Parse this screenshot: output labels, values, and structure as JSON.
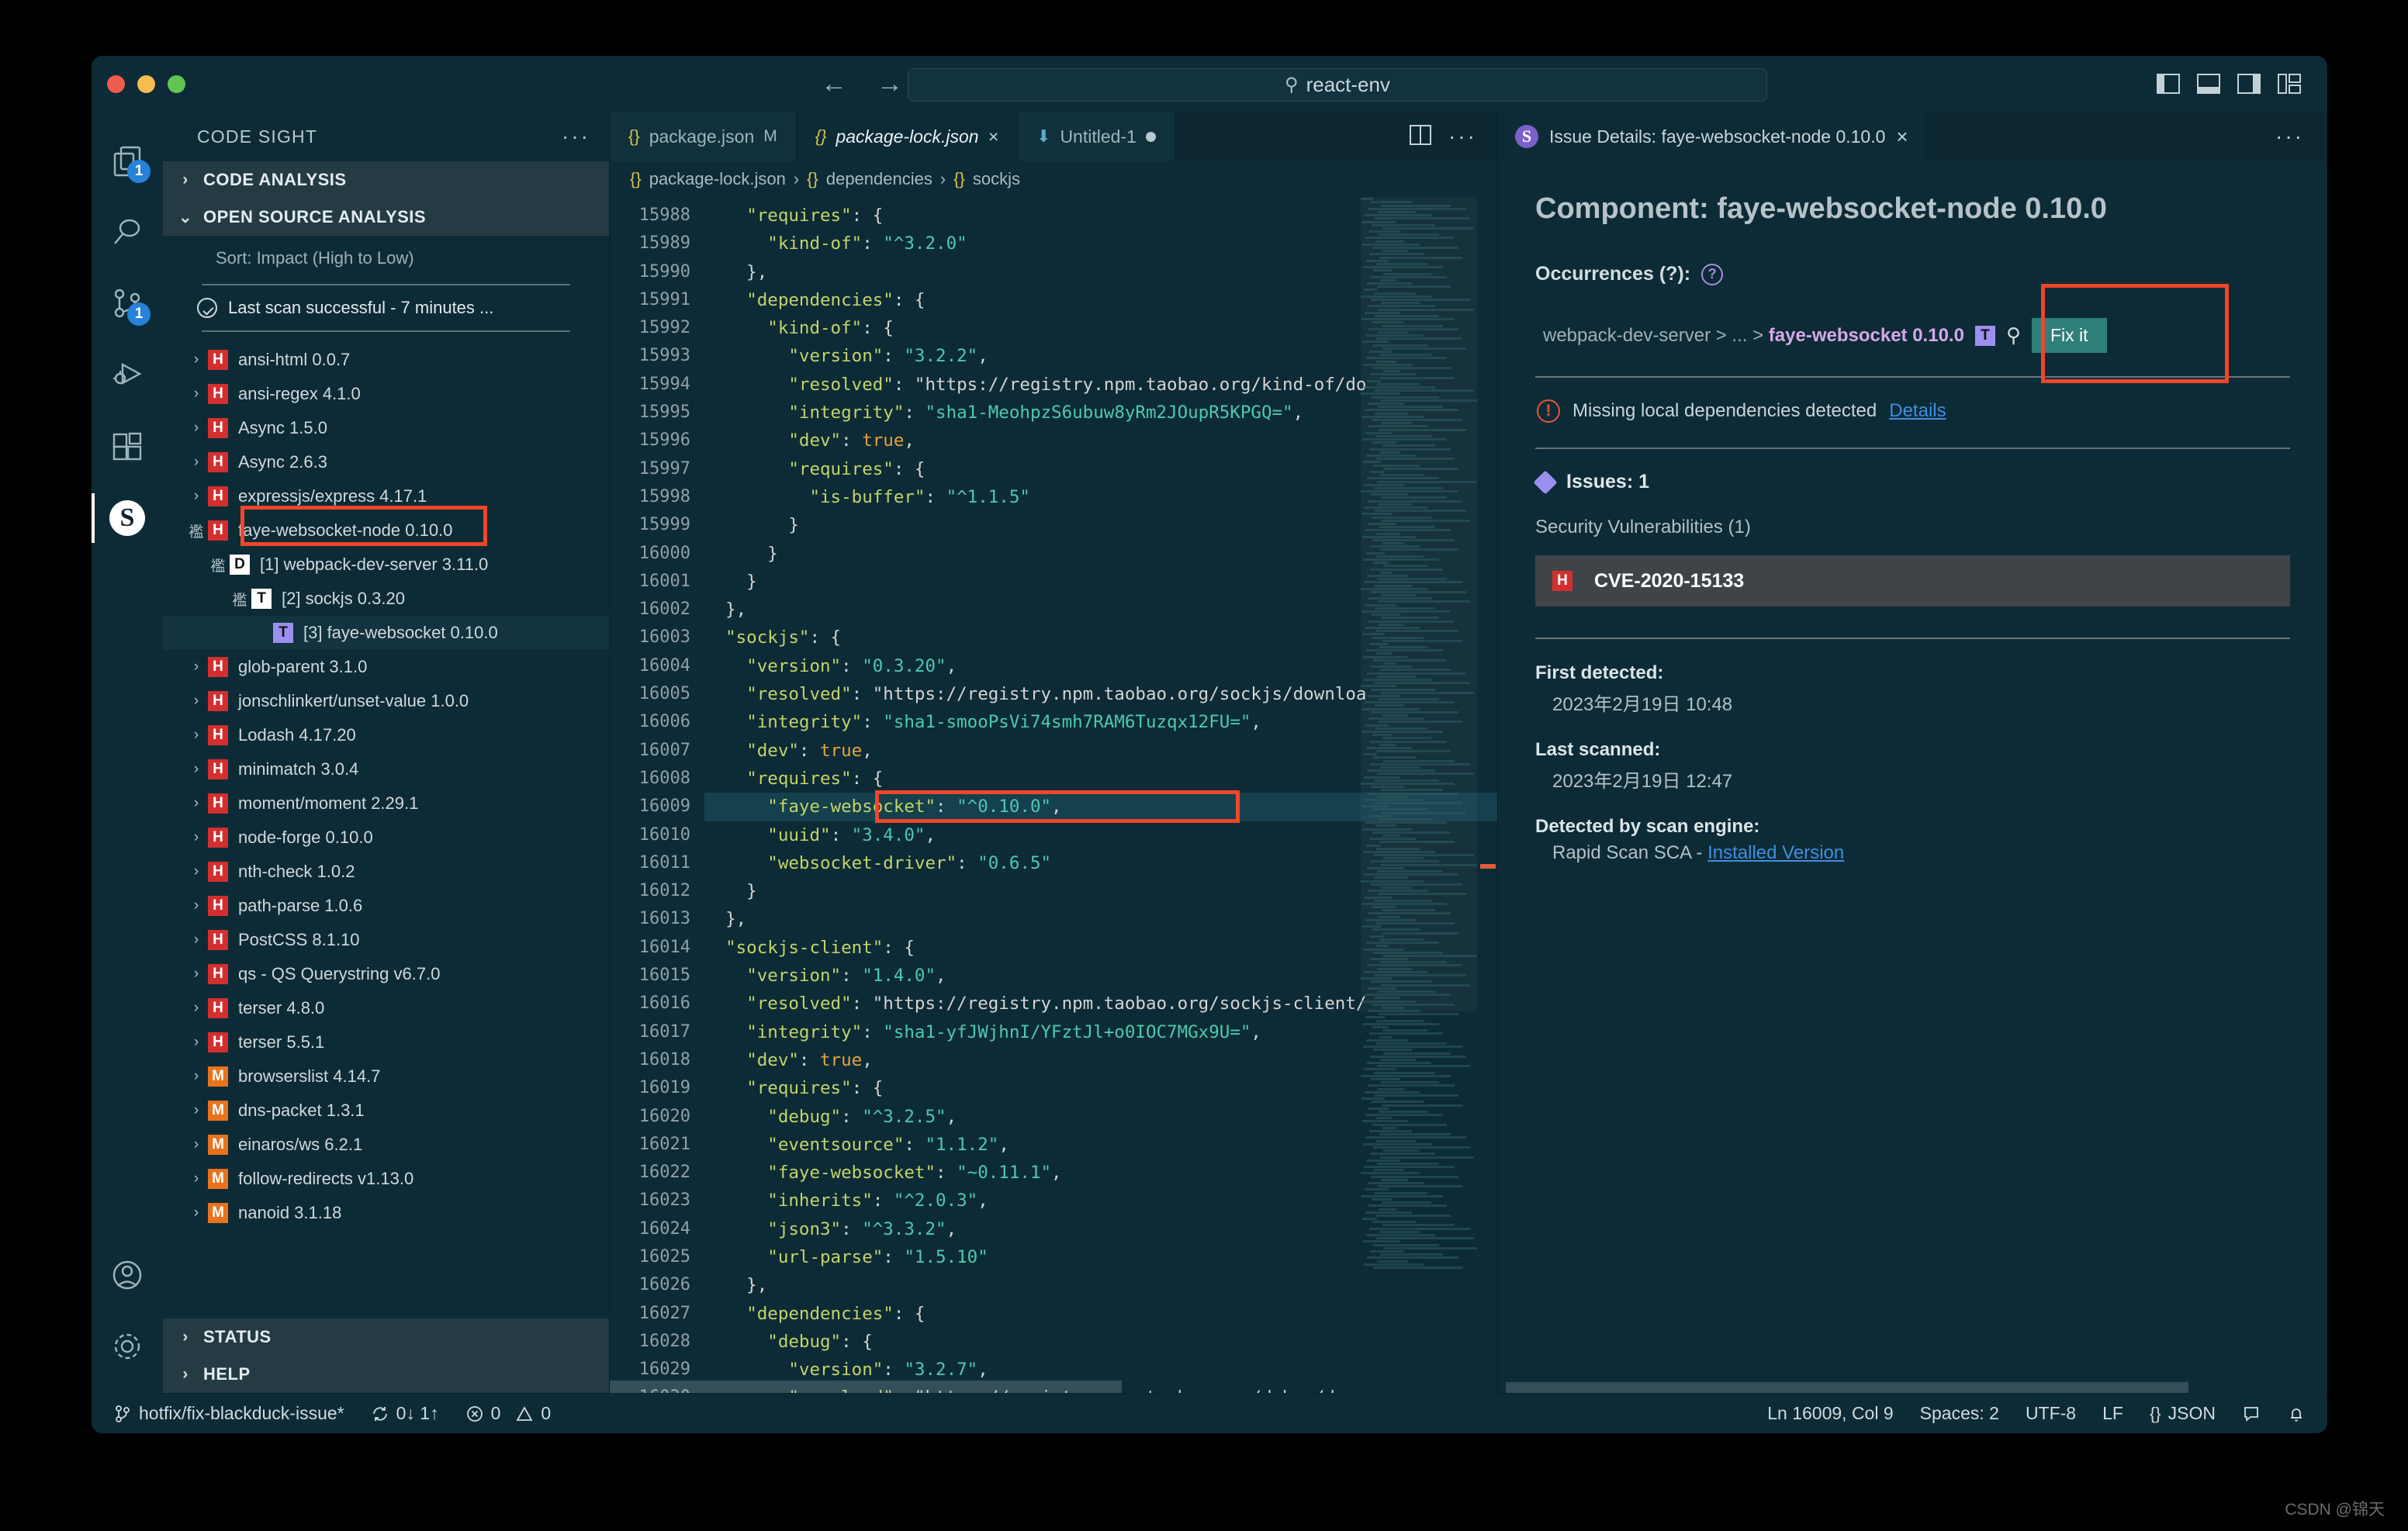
{
  "titlebar": {
    "omnibox_value": "react-env",
    "search_icon": "search-icon",
    "back_icon": "arrow-left-icon",
    "forward_icon": "arrow-right-icon"
  },
  "activity_bar": {
    "items": [
      {
        "name": "explorer",
        "icon": "files-icon",
        "badge": "1"
      },
      {
        "name": "search",
        "icon": "search-icon",
        "badge": ""
      },
      {
        "name": "source-control",
        "icon": "source-control-icon",
        "badge": "1"
      },
      {
        "name": "run-and-debug",
        "icon": "run-debug-icon",
        "badge": ""
      },
      {
        "name": "extensions",
        "icon": "extensions-icon",
        "badge": ""
      },
      {
        "name": "code-sight",
        "icon": "synopsys-s-icon",
        "badge": "",
        "letter": "S"
      }
    ],
    "bottom": [
      {
        "name": "accounts",
        "icon": "account-icon"
      },
      {
        "name": "settings",
        "icon": "gear-icon"
      }
    ]
  },
  "sidebar": {
    "title": "CODE SIGHT",
    "more_label": "···",
    "sections": [
      {
        "label": "CODE ANALYSIS",
        "expanded": false,
        "chevron": "chevron-right-icon"
      },
      {
        "label": "OPEN SOURCE ANALYSIS",
        "expanded": true,
        "chevron": "chevron-down-icon"
      }
    ],
    "sort_label": "Sort: Impact (High to Low)",
    "scan_status": "Last scan successful - 7 minutes ...",
    "tree": [
      {
        "label": "ansi-html 0.0.7",
        "sev": "H",
        "indent": 0,
        "arrow": "›"
      },
      {
        "label": "ansi-regex 4.1.0",
        "sev": "H",
        "indent": 0,
        "arrow": "›"
      },
      {
        "label": "Async 1.5.0",
        "sev": "H",
        "indent": 0,
        "arrow": "›"
      },
      {
        "label": "Async 2.6.3",
        "sev": "H",
        "indent": 0,
        "arrow": "›"
      },
      {
        "label": "expressjs/express 4.17.1",
        "sev": "H",
        "indent": 0,
        "arrow": "›"
      },
      {
        "label": "faye-websocket-node 0.10.0",
        "sev": "H",
        "indent": 0,
        "arrow": "∨"
      },
      {
        "label": "[1] webpack-dev-server 3.11.0",
        "sev": "D",
        "indent": 1,
        "arrow": "∨"
      },
      {
        "label": "[2] sockjs 0.3.20",
        "sev": "T",
        "indent": 2,
        "arrow": "∨"
      },
      {
        "label": "[3] faye-websocket 0.10.0",
        "sev": "Tsel",
        "indent": 3,
        "arrow": "",
        "selected": true
      },
      {
        "label": "glob-parent 3.1.0",
        "sev": "H",
        "indent": 0,
        "arrow": "›"
      },
      {
        "label": "jonschlinkert/unset-value 1.0.0",
        "sev": "H",
        "indent": 0,
        "arrow": "›"
      },
      {
        "label": "Lodash 4.17.20",
        "sev": "H",
        "indent": 0,
        "arrow": "›"
      },
      {
        "label": "minimatch 3.0.4",
        "sev": "H",
        "indent": 0,
        "arrow": "›"
      },
      {
        "label": "moment/moment 2.29.1",
        "sev": "H",
        "indent": 0,
        "arrow": "›"
      },
      {
        "label": "node-forge 0.10.0",
        "sev": "H",
        "indent": 0,
        "arrow": "›"
      },
      {
        "label": "nth-check 1.0.2",
        "sev": "H",
        "indent": 0,
        "arrow": "›"
      },
      {
        "label": "path-parse 1.0.6",
        "sev": "H",
        "indent": 0,
        "arrow": "›"
      },
      {
        "label": "PostCSS 8.1.10",
        "sev": "H",
        "indent": 0,
        "arrow": "›"
      },
      {
        "label": "qs -  QS Querystring v6.7.0",
        "sev": "H",
        "indent": 0,
        "arrow": "›"
      },
      {
        "label": "terser 4.8.0",
        "sev": "H",
        "indent": 0,
        "arrow": "›"
      },
      {
        "label": "terser 5.5.1",
        "sev": "H",
        "indent": 0,
        "arrow": "›"
      },
      {
        "label": "browserslist 4.14.7",
        "sev": "M",
        "indent": 0,
        "arrow": "›"
      },
      {
        "label": "dns-packet 1.3.1",
        "sev": "M",
        "indent": 0,
        "arrow": "›"
      },
      {
        "label": "einaros/ws 6.2.1",
        "sev": "M",
        "indent": 0,
        "arrow": "›"
      },
      {
        "label": "follow-redirects v1.13.0",
        "sev": "M",
        "indent": 0,
        "arrow": "›"
      },
      {
        "label": "nanoid 3.1.18",
        "sev": "M",
        "indent": 0,
        "arrow": "›"
      }
    ],
    "footer_sections": [
      {
        "label": "STATUS",
        "chevron": "chevron-right-icon"
      },
      {
        "label": "HELP",
        "chevron": "chevron-right-icon"
      }
    ]
  },
  "editor": {
    "tabs": [
      {
        "label": "package.json",
        "modified_mark": "M",
        "active": false,
        "icon": "json-braces-icon"
      },
      {
        "label": "package-lock.json",
        "close": "×",
        "active": true,
        "icon": "json-braces-icon"
      },
      {
        "label": "Untitled-1",
        "dirty_dot": true,
        "active": false,
        "icon": "download-arrow-icon"
      }
    ],
    "tab_actions": [
      {
        "name": "split-editor-icon"
      },
      {
        "name": "more-actions-icon",
        "label": "···"
      }
    ],
    "breadcrumb": [
      {
        "icon": "json-braces-icon",
        "label": "package-lock.json"
      },
      {
        "icon": "json-braces-icon",
        "label": "dependencies"
      },
      {
        "icon": "json-braces-icon",
        "label": "sockjs"
      }
    ],
    "first_line_number": 15988,
    "lines": [
      {
        "n": 15988,
        "text": "    \"requires\": {"
      },
      {
        "n": 15989,
        "text": "      \"kind-of\": \"^3.2.0\""
      },
      {
        "n": 15990,
        "text": "    },"
      },
      {
        "n": 15991,
        "text": "    \"dependencies\": {"
      },
      {
        "n": 15992,
        "text": "      \"kind-of\": {"
      },
      {
        "n": 15993,
        "text": "        \"version\": \"3.2.2\","
      },
      {
        "n": 15994,
        "text": "        \"resolved\": \"https://registry.npm.taobao.org/kind-of/do"
      },
      {
        "n": 15995,
        "text": "        \"integrity\": \"sha1-MeohpzS6ubuw8yRm2JOupR5KPGQ=\","
      },
      {
        "n": 15996,
        "text": "        \"dev\": true,"
      },
      {
        "n": 15997,
        "text": "        \"requires\": {"
      },
      {
        "n": 15998,
        "text": "          \"is-buffer\": \"^1.1.5\""
      },
      {
        "n": 15999,
        "text": "        }"
      },
      {
        "n": 16000,
        "text": "      }"
      },
      {
        "n": 16001,
        "text": "    }"
      },
      {
        "n": 16002,
        "text": "  },"
      },
      {
        "n": 16003,
        "text": "  \"sockjs\": {"
      },
      {
        "n": 16004,
        "text": "    \"version\": \"0.3.20\","
      },
      {
        "n": 16005,
        "text": "    \"resolved\": \"https://registry.npm.taobao.org/sockjs/downloa"
      },
      {
        "n": 16006,
        "text": "    \"integrity\": \"sha1-smooPsVi74smh7RAM6Tuzqx12FU=\","
      },
      {
        "n": 16007,
        "text": "    \"dev\": true,"
      },
      {
        "n": 16008,
        "text": "    \"requires\": {"
      },
      {
        "n": 16009,
        "text": "      \"faye-websocket\": \"^0.10.0\",",
        "highlighted": true
      },
      {
        "n": 16010,
        "text": "      \"uuid\": \"3.4.0\","
      },
      {
        "n": 16011,
        "text": "      \"websocket-driver\": \"0.6.5\""
      },
      {
        "n": 16012,
        "text": "    }"
      },
      {
        "n": 16013,
        "text": "  },"
      },
      {
        "n": 16014,
        "text": "  \"sockjs-client\": {"
      },
      {
        "n": 16015,
        "text": "    \"version\": \"1.4.0\","
      },
      {
        "n": 16016,
        "text": "    \"resolved\": \"https://registry.npm.taobao.org/sockjs-client/"
      },
      {
        "n": 16017,
        "text": "    \"integrity\": \"sha1-yfJWjhnI/YFztJl+o0IOC7MGx9U=\","
      },
      {
        "n": 16018,
        "text": "    \"dev\": true,"
      },
      {
        "n": 16019,
        "text": "    \"requires\": {"
      },
      {
        "n": 16020,
        "text": "      \"debug\": \"^3.2.5\","
      },
      {
        "n": 16021,
        "text": "      \"eventsource\": \"1.1.2\","
      },
      {
        "n": 16022,
        "text": "      \"faye-websocket\": \"~0.11.1\","
      },
      {
        "n": 16023,
        "text": "      \"inherits\": \"^2.0.3\","
      },
      {
        "n": 16024,
        "text": "      \"json3\": \"^3.3.2\","
      },
      {
        "n": 16025,
        "text": "      \"url-parse\": \"1.5.10\""
      },
      {
        "n": 16026,
        "text": "    },"
      },
      {
        "n": 16027,
        "text": "    \"dependencies\": {"
      },
      {
        "n": 16028,
        "text": "      \"debug\": {"
      },
      {
        "n": 16029,
        "text": "        \"version\": \"3.2.7\","
      },
      {
        "n": 16030,
        "text": "        \"resolved\": \"https://registry.npm.taobao.org/debug/down"
      }
    ]
  },
  "issue_panel": {
    "tab_label": "Issue Details: faye-websocket-node 0.10.0",
    "tab_close": "×",
    "tab_icon": "synopsys-s-icon",
    "more_label": "···",
    "heading": "Component: faye-websocket-node 0.10.0",
    "occurrences_label": "Occurrences (?):",
    "help_icon": "question-mark-icon",
    "occurrence": {
      "path_prefix": "webpack-dev-server > ... > ",
      "path_target": "faye-websocket 0.10.0",
      "type_badge": "T",
      "search_icon": "magnifier-icon",
      "fix_button": "Fix it"
    },
    "warning": {
      "icon": "exclamation-circle-icon",
      "text": "Missing local dependencies detected",
      "link": "Details"
    },
    "issues_label": "Issues: 1",
    "issues_icon": "diamond-icon",
    "vuln_section_label": "Security Vulnerabilities (1)",
    "cves": [
      {
        "sev": "H",
        "id": "CVE-2020-15133"
      }
    ],
    "meta": [
      {
        "label": "First detected:",
        "value": "2023年2月19日 10:48"
      },
      {
        "label": "Last scanned:",
        "value": "2023年2月19日 12:47"
      }
    ],
    "engine_label": "Detected by scan engine:",
    "engine_value": "Rapid Scan SCA - ",
    "engine_link": "Installed Version"
  },
  "statusbar": {
    "branch_icon": "source-control-icon",
    "branch": "hotfix/fix-blackduck-issue*",
    "sync_icon": "sync-icon",
    "sync": "0↓ 1↑",
    "errors_icon": "error-circle-icon",
    "errors": "0",
    "warnings_icon": "warning-triangle-icon",
    "warnings": "0",
    "position": "Ln 16009, Col 9",
    "spaces": "Spaces: 2",
    "encoding": "UTF-8",
    "eol": "LF",
    "language_icon": "json-braces-icon",
    "language": "JSON",
    "feedback_icon": "feedback-icon",
    "bell_icon": "bell-icon"
  },
  "watermark": "CSDN @锦天",
  "colors": {
    "accent_blue": "#2682d9",
    "severity_high": "#d32f2f",
    "severity_medium": "#e8731c",
    "fix_button": "#2f7f7b",
    "highlight_box": "#f0462a",
    "link": "#3f8fe0",
    "purple_badge": "#9b8ff0"
  }
}
